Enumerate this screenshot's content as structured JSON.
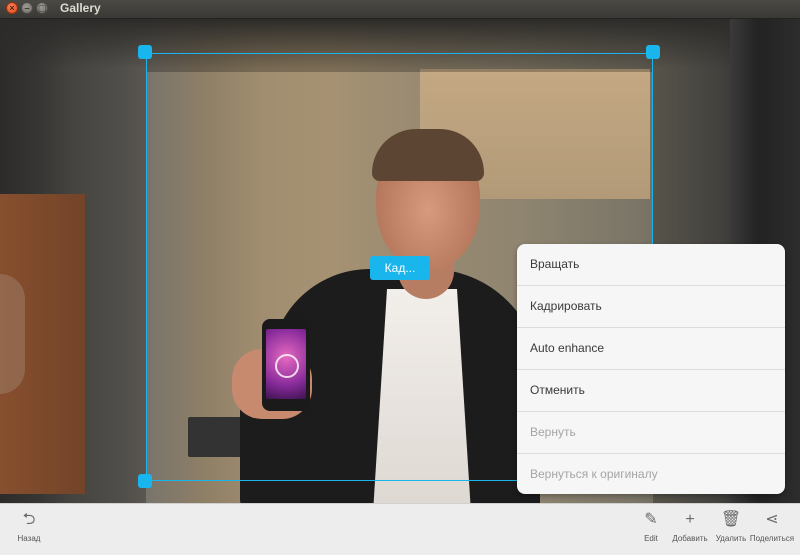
{
  "window": {
    "title": "Gallery",
    "close_glyph": "×",
    "minimize_glyph": "–",
    "maximize_glyph": "▢"
  },
  "accent_color": "#19b6ee",
  "crop": {
    "label": "Кад..."
  },
  "menu": {
    "items": [
      {
        "label": "Вращать",
        "enabled": true
      },
      {
        "label": "Кадрировать",
        "enabled": true
      },
      {
        "label": "Auto enhance",
        "enabled": true
      },
      {
        "label": "Отменить",
        "enabled": true
      },
      {
        "label": "Вернуть",
        "enabled": false
      },
      {
        "label": "Вернуться к оригиналу",
        "enabled": false
      }
    ]
  },
  "toolbar": {
    "back": {
      "label": "Назад",
      "icon": "back-arrow-icon",
      "glyph": "⮌"
    },
    "edit": {
      "label": "Edit",
      "icon": "pencil-icon",
      "glyph": "✎"
    },
    "add": {
      "label": "Добавить",
      "icon": "plus-icon",
      "glyph": "+"
    },
    "delete": {
      "label": "Удалить",
      "icon": "trash-icon",
      "glyph": "🗑"
    },
    "share": {
      "label": "Поделиться",
      "icon": "share-icon",
      "glyph": "⋖"
    }
  }
}
